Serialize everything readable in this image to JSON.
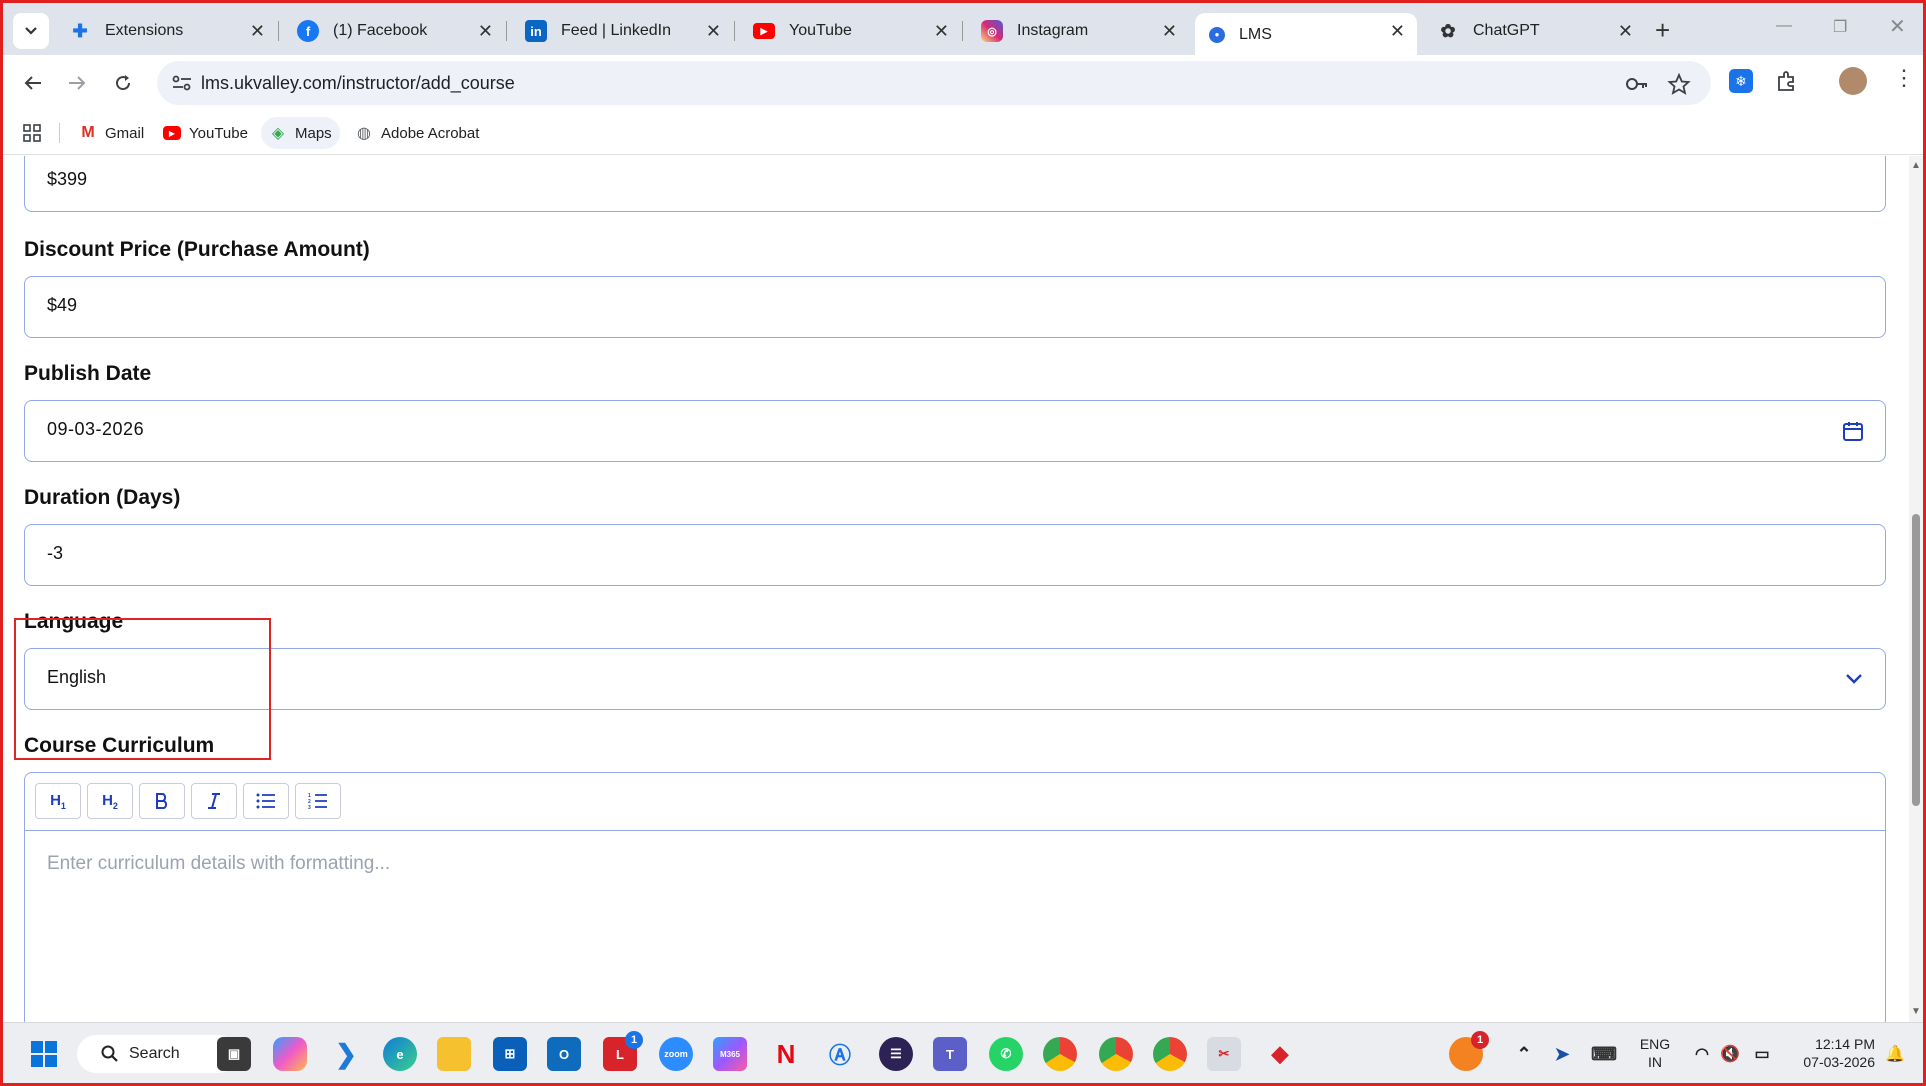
{
  "browser": {
    "tabs": [
      {
        "title": "Extensions",
        "icon": "puzzle-icon",
        "color": "#1a73e8"
      },
      {
        "title": "(1) Facebook",
        "icon": "facebook-icon",
        "color": "#1877f2"
      },
      {
        "title": "Feed | LinkedIn",
        "icon": "linkedin-icon",
        "color": "#0a66c2"
      },
      {
        "title": "YouTube",
        "icon": "youtube-icon",
        "color": "#ff0000"
      },
      {
        "title": "Instagram",
        "icon": "instagram-icon",
        "color": "#d62976"
      },
      {
        "title": "LMS",
        "icon": "lms-icon",
        "color": "#2b6de0"
      },
      {
        "title": "ChatGPT",
        "icon": "chatgpt-icon",
        "color": "#333333"
      }
    ],
    "active_tab": "LMS",
    "url": "lms.ukvalley.com/instructor/add_course",
    "bookmarks": [
      {
        "label": "Gmail",
        "icon": "gmail-icon"
      },
      {
        "label": "YouTube",
        "icon": "youtube-icon"
      },
      {
        "label": "Maps",
        "icon": "maps-icon"
      },
      {
        "label": "Adobe Acrobat",
        "icon": "globe-icon"
      }
    ]
  },
  "form": {
    "price_value": "$399",
    "discount_label": "Discount Price (Purchase Amount)",
    "discount_value": "$49",
    "publish_label": "Publish Date",
    "publish_value": "09-03-2026",
    "duration_label": "Duration (Days)",
    "duration_value": "-3",
    "language_label": "Language",
    "language_value": "English",
    "curriculum_label": "Course Curriculum",
    "curriculum_placeholder": "Enter curriculum details with formatting...",
    "editor_buttons": [
      "H1",
      "H2",
      "B",
      "I",
      "bullet-list",
      "numbered-list"
    ]
  },
  "taskbar": {
    "search_label": "Search",
    "lang_line1": "ENG",
    "lang_line2": "IN",
    "time": "12:14 PM",
    "date": "07-03-2026",
    "notification_badge_l": "1",
    "notification_badge_orange": "1"
  },
  "colors": {
    "accent_blue": "#1d3fbf",
    "field_border": "#93a8e6",
    "highlight_red": "#e02424"
  }
}
